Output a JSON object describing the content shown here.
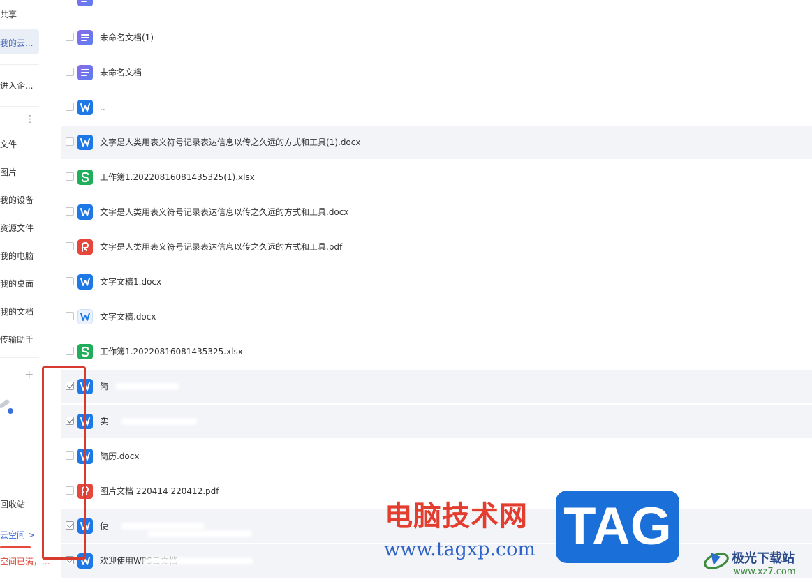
{
  "sidebar": {
    "items": [
      {
        "label": "共享",
        "top": 0
      },
      {
        "label": "我的云...",
        "top": 0
      },
      {
        "label": "进入企...",
        "top": 0
      },
      {
        "label": "文件"
      },
      {
        "label": "图片"
      },
      {
        "label": "我的设备"
      },
      {
        "label": "资源文件"
      },
      {
        "label": "我的电脑"
      },
      {
        "label": "我的桌面"
      },
      {
        "label": "我的文档"
      },
      {
        "label": "传输助手"
      }
    ],
    "recycle": "回收站",
    "space_link": "云空间 >",
    "warning": "空间已满，...",
    "more_glyph": "⋮",
    "plus_glyph": "+"
  },
  "files": [
    {
      "name": "未命名文档(1)",
      "icon": "doc-purple-icon",
      "checked": false,
      "highlight": false
    },
    {
      "name": "未命名文档",
      "icon": "doc-purple-icon",
      "checked": false,
      "highlight": false
    },
    {
      "name": "..",
      "icon": "word-icon",
      "checked": false,
      "highlight": false
    },
    {
      "name": "文字是人类用表义符号记录表达信息以传之久远的方式和工具(1).docx",
      "icon": "word-icon",
      "checked": false,
      "highlight": true
    },
    {
      "name": "工作簿1.20220816081435325(1).xlsx",
      "icon": "sheet-icon",
      "checked": false,
      "highlight": false
    },
    {
      "name": "文字是人类用表义符号记录表达信息以传之久远的方式和工具.docx",
      "icon": "word-icon",
      "checked": false,
      "highlight": false
    },
    {
      "name": "文字是人类用表义符号记录表达信息以传之久远的方式和工具.pdf",
      "icon": "pdf-icon",
      "checked": false,
      "highlight": false
    },
    {
      "name": "文字文稿1.docx",
      "icon": "word-icon",
      "checked": false,
      "highlight": false
    },
    {
      "name": "文字文稿.docx",
      "icon": "word-outline-icon",
      "checked": false,
      "highlight": false
    },
    {
      "name": "工作簿1.20220816081435325.xlsx",
      "icon": "sheet-icon",
      "checked": false,
      "highlight": false
    },
    {
      "name": "简",
      "icon": "word-icon",
      "checked": true,
      "highlight": true
    },
    {
      "name": "实",
      "icon": "word-icon",
      "checked": true,
      "highlight": true
    },
    {
      "name": "简历.docx",
      "icon": "word-icon",
      "checked": false,
      "highlight": false
    },
    {
      "name": "图片文档 220414 220412.pdf",
      "icon": "pdf-icon",
      "checked": false,
      "highlight": false
    },
    {
      "name": "使",
      "icon": "word-icon",
      "checked": true,
      "highlight": true
    },
    {
      "name": "欢迎使用WPS云文档",
      "icon": "word-icon",
      "checked": true,
      "highlight": true
    }
  ],
  "watermark": {
    "cn": "电脑技术网",
    "url": "www.tagxp.com",
    "tag": "TAG",
    "xz": "极光下载站",
    "xz_url": "www.xz7.com"
  },
  "colors": {
    "word": "#1e78e6",
    "sheet": "#1fae5a",
    "pdf": "#e5473d",
    "doc_purple": "#6b73e8",
    "annotation": "#d93a2e"
  }
}
